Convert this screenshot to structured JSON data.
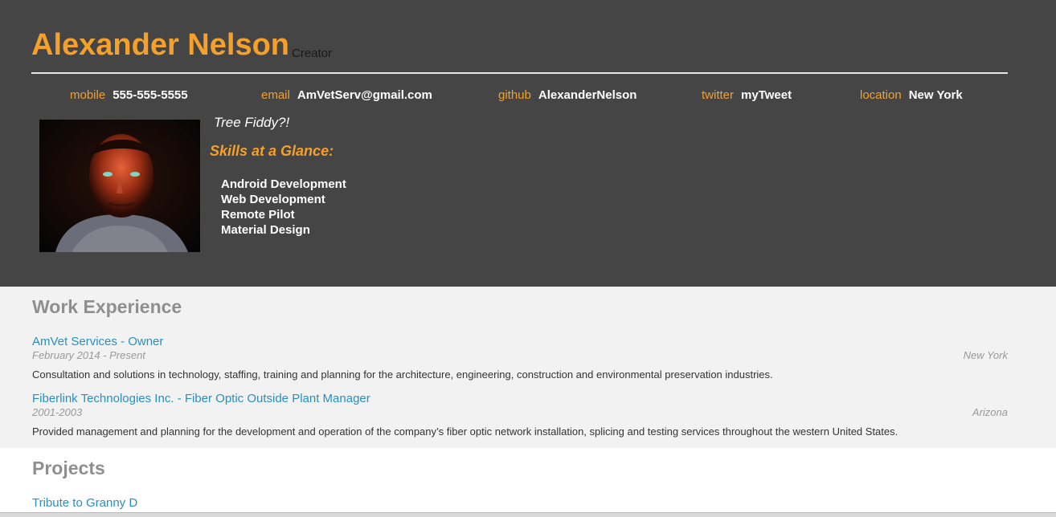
{
  "header": {
    "name": "Alexander Nelson",
    "role": "Creator",
    "contacts": [
      {
        "key": "mobile",
        "value": "555-555-5555"
      },
      {
        "key": "email",
        "value": "AmVetServ@gmail.com"
      },
      {
        "key": "github",
        "value": "AlexanderNelson"
      },
      {
        "key": "twitter",
        "value": "myTweet"
      },
      {
        "key": "location",
        "value": "New York"
      }
    ],
    "tagline": "Tree Fiddy?!",
    "skills_title": "Skills at a Glance:",
    "skills": [
      "Android Development",
      "Web Development",
      "Remote Pilot",
      "Material Design"
    ]
  },
  "work": {
    "title": "Work Experience",
    "jobs": [
      {
        "title": "AmVet Services - Owner",
        "dates": "February 2014 - Present",
        "location": "New York",
        "description": "Consultation and solutions in technology, staffing, training and planning for the architecture, engineering, construction and environmental preservation industries."
      },
      {
        "title": "Fiberlink Technologies Inc. - Fiber Optic Outside Plant Manager",
        "dates": "2001-2003",
        "location": "Arizona",
        "description": "Provided management and planning for the development and operation of the company’s fiber optic network installation, splicing and testing services throughout the western United States."
      }
    ]
  },
  "projects": {
    "title": "Projects",
    "items": [
      {
        "title": "Tribute to Granny D"
      }
    ]
  },
  "colors": {
    "header_bg": "#454545",
    "accent_orange": "#f4a02b",
    "link_blue": "#2a8fbd",
    "section_title_gray": "#8f8f8f",
    "work_bg": "#f2f2f2"
  }
}
